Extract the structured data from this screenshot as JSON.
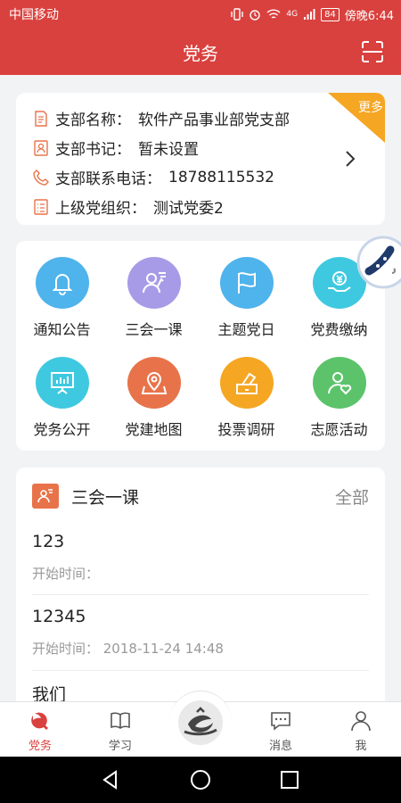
{
  "status": {
    "carrier": "中国移动",
    "battery": "84",
    "network": "4G",
    "time": "傍晚6:44"
  },
  "header": {
    "title": "党务"
  },
  "branch": {
    "more_label": "更多",
    "rows": [
      {
        "key": "支部名称：",
        "value": "软件产品事业部党支部"
      },
      {
        "key": "支部书记：",
        "value": "暂未设置"
      },
      {
        "key": "支部联系电话：",
        "value": "18788115532"
      },
      {
        "key": "上级党组织：",
        "value": "测试党委2"
      }
    ]
  },
  "grid": [
    {
      "label": "通知公告",
      "icon": "bell-icon",
      "color": "#4fb3ec"
    },
    {
      "label": "三会一课",
      "icon": "lecture-icon",
      "color": "#a79be8"
    },
    {
      "label": "主题党日",
      "icon": "flag-icon",
      "color": "#4fb3ec"
    },
    {
      "label": "党费缴纳",
      "icon": "yuan-hand-icon",
      "color": "#3ec9e0"
    },
    {
      "label": "党务公开",
      "icon": "presentation-icon",
      "color": "#3ec9e0"
    },
    {
      "label": "党建地图",
      "icon": "map-pin-icon",
      "color": "#e8734a"
    },
    {
      "label": "投票调研",
      "icon": "vote-icon",
      "color": "#f5a623"
    },
    {
      "label": "志愿活动",
      "icon": "volunteer-icon",
      "color": "#5cc36b"
    }
  ],
  "meetings": {
    "title": "三会一课",
    "all_label": "全部",
    "items": [
      {
        "name": "123",
        "time": "开始时间："
      },
      {
        "name": "12345",
        "time": "开始时间：  2018-11-24 14:48"
      },
      {
        "name": "我们"
      }
    ]
  },
  "tabs": [
    {
      "label": "党务"
    },
    {
      "label": "学习"
    },
    {
      "label": "消息"
    },
    {
      "label": "我"
    }
  ],
  "colors": {
    "brand": "#d9413e",
    "ribbon": "#f5a623"
  }
}
